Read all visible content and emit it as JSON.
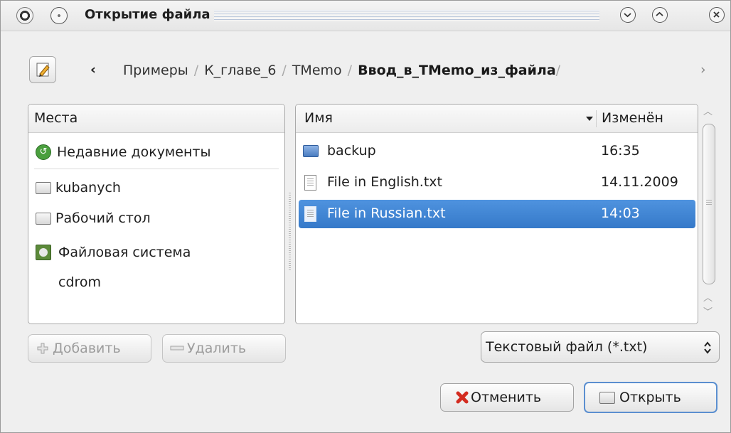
{
  "window": {
    "title": "Открытие файла"
  },
  "path": {
    "back_glyph": "‹",
    "forward_glyph": "›",
    "crumbs": [
      "Примеры",
      "К_главе_6",
      "TMemo"
    ],
    "current": "Ввод_в_TMemo_из_файла",
    "trailing_sep": "/"
  },
  "places": {
    "header": "Места",
    "items": [
      {
        "label": "Недавние документы",
        "icon": "recent-documents-icon"
      },
      {
        "label": "kubanych",
        "icon": "folder-icon"
      },
      {
        "label": "Рабочий стол",
        "icon": "folder-icon"
      },
      {
        "label": "Файловая система",
        "icon": "filesystem-icon"
      },
      {
        "label": "cdrom",
        "icon": "none"
      }
    ]
  },
  "files": {
    "col_name": "Имя",
    "col_modified": "Изменён",
    "rows": [
      {
        "name": "backup",
        "modified": "16:35",
        "type": "folder",
        "selected": false
      },
      {
        "name": "File in English.txt",
        "modified": "14.11.2009",
        "type": "text",
        "selected": false
      },
      {
        "name": "File in Russian.txt",
        "modified": "14:03",
        "type": "text",
        "selected": true
      }
    ]
  },
  "buttons": {
    "add": "Добавить",
    "remove": "Удалить",
    "cancel": "Отменить",
    "open": "Открыть"
  },
  "filter": {
    "selected": "Текстовый файл (*.txt)"
  },
  "colors": {
    "selection": "#3b7fd0",
    "window_bg": "#efefef"
  }
}
